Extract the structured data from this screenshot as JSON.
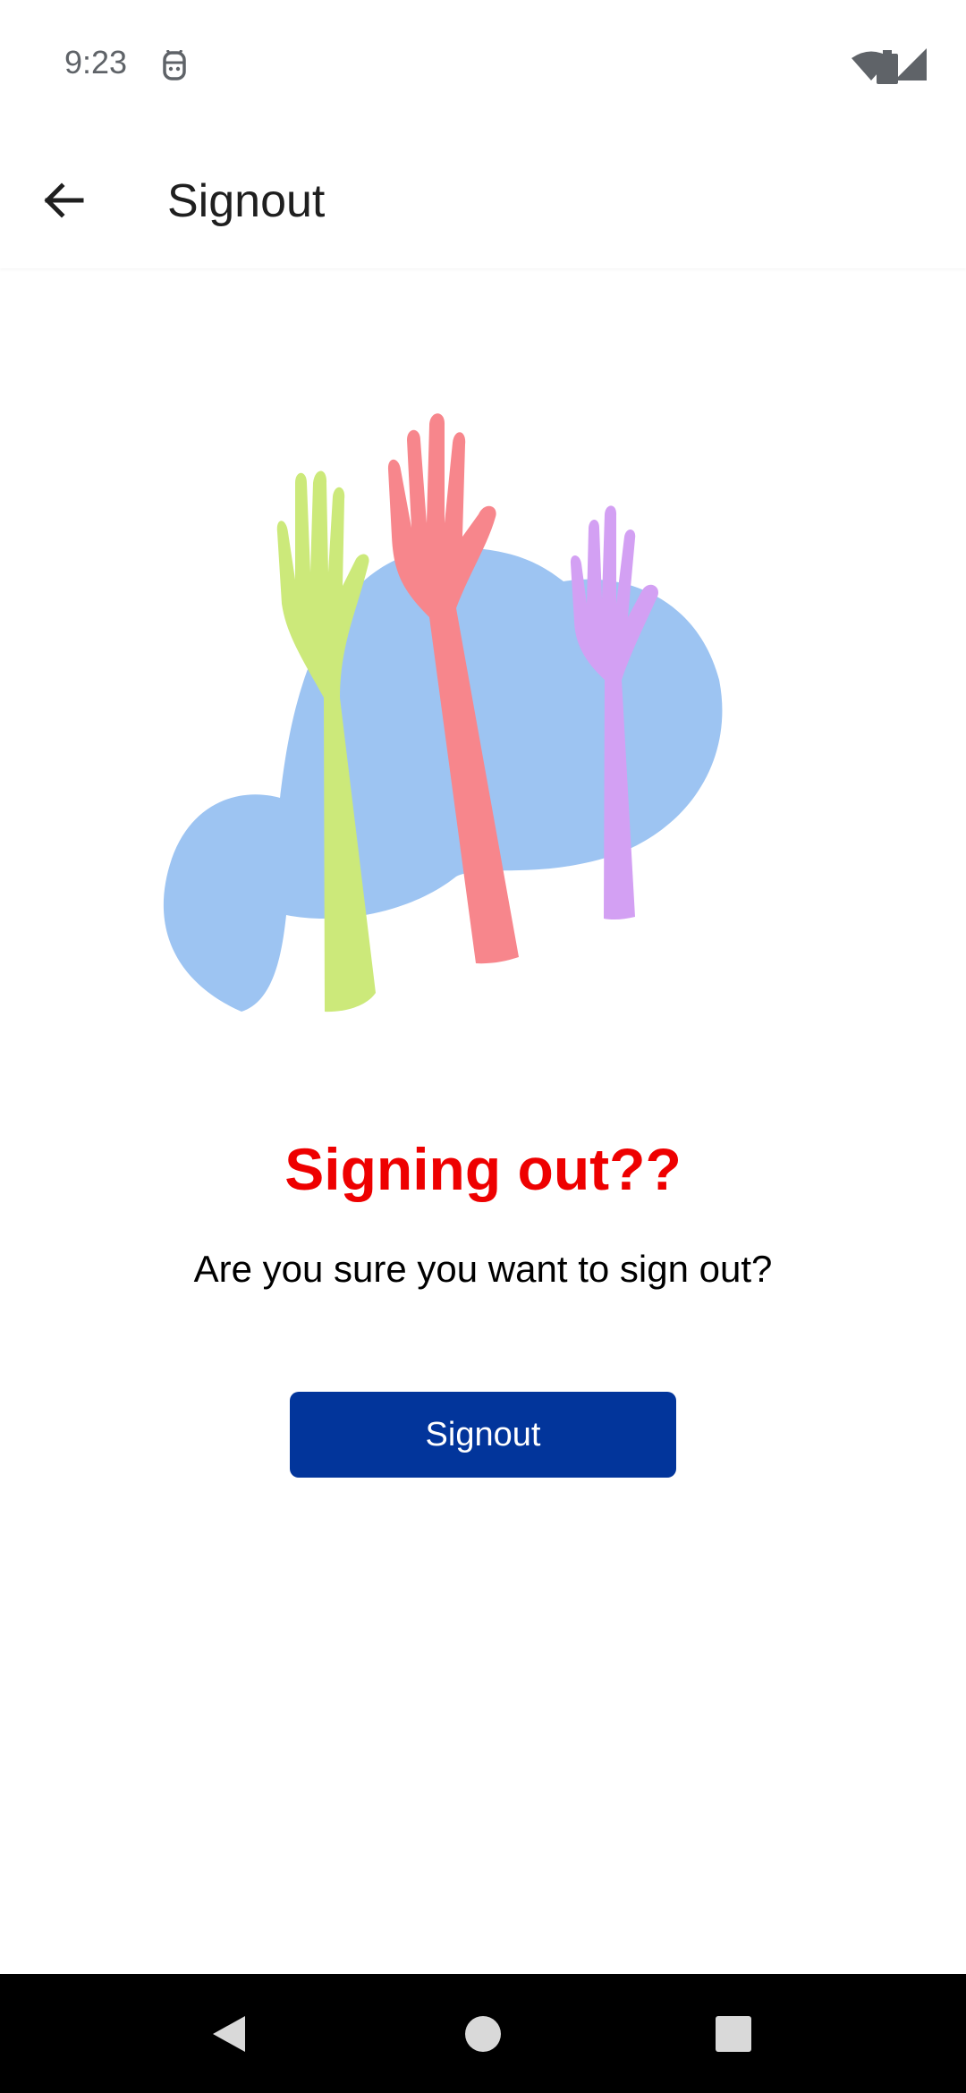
{
  "status_bar": {
    "time": "9:23",
    "icons": [
      "app-notification-icon",
      "wifi-icon",
      "cell-signal-icon",
      "battery-icon"
    ]
  },
  "app_bar": {
    "back_icon": "arrow-left-icon",
    "title": "Signout"
  },
  "illustration": {
    "name": "raised-hands-illustration",
    "colors": {
      "blob": "#9dc4f2",
      "hand_green": "#cce97a",
      "hand_red": "#f7868c",
      "hand_purple": "#d3a0f3"
    }
  },
  "content": {
    "heading": "Signing out??",
    "message": "Are you sure you want to sign out?",
    "button_label": "Signout"
  },
  "nav_bar": {
    "buttons": [
      "back-triangle-icon",
      "home-circle-icon",
      "recents-square-icon"
    ]
  },
  "colors": {
    "heading": "#ee0000",
    "button_bg": "#02359b",
    "button_text": "#ffffff"
  }
}
